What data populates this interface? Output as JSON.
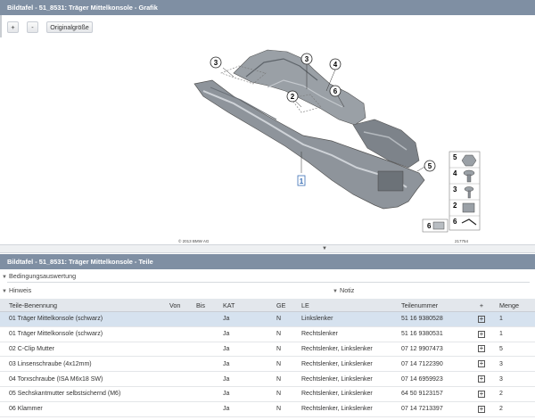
{
  "graphic_panel": {
    "title": "Bildtafel - 51_8531: Träger Mittelkonsole - Grafik"
  },
  "toolbar": {
    "zoom_in": "+",
    "zoom_out": "-",
    "original_size": "Originalgröße"
  },
  "diagram": {
    "callouts": [
      "3",
      "3",
      "4",
      "2",
      "6",
      "1",
      "5"
    ],
    "side_callouts": [
      "5",
      "4",
      "3",
      "2",
      "6"
    ],
    "copyright": "© 2013 BMW AG",
    "figure_number": "217754"
  },
  "parts_panel": {
    "title": "Bildtafel - 51_8531: Träger Mittelkonsole - Teile",
    "conditions_label": "Bedingungsauswertung",
    "hint_label": "Hinweis",
    "note_label": "Notiz",
    "columns": [
      "Teile-Benennung",
      "Von",
      "Bis",
      "KAT",
      "GE",
      "LE",
      "Teilenummer",
      "+",
      "Menge"
    ],
    "rows": [
      {
        "name": "01 Träger Mittelkonsole (schwarz)",
        "von": "",
        "bis": "",
        "kat": "Ja",
        "ge": "N",
        "le": "Linkslenker",
        "part": "51 16 9380528",
        "qty": "1"
      },
      {
        "name": "01 Träger Mittelkonsole (schwarz)",
        "von": "",
        "bis": "",
        "kat": "Ja",
        "ge": "N",
        "le": "Rechtslenker",
        "part": "51 16 9380531",
        "qty": "1"
      },
      {
        "name": "02 C-Clip Mutter",
        "von": "",
        "bis": "",
        "kat": "Ja",
        "ge": "N",
        "le": "Rechtslenker, Linkslenker",
        "part": "07 12 9907473",
        "qty": "5"
      },
      {
        "name": "03 Linsenschraube (4x12mm)",
        "von": "",
        "bis": "",
        "kat": "Ja",
        "ge": "N",
        "le": "Rechtslenker, Linkslenker",
        "part": "07 14 7122390",
        "qty": "3"
      },
      {
        "name": "04 Torxschraube (ISA M6x18 SW)",
        "von": "",
        "bis": "",
        "kat": "Ja",
        "ge": "N",
        "le": "Rechtslenker, Linkslenker",
        "part": "07 14 6959923",
        "qty": "3"
      },
      {
        "name": "05 Sechskantmutter selbstsichernd (M6)",
        "von": "",
        "bis": "",
        "kat": "Ja",
        "ge": "N",
        "le": "Rechtslenker, Linkslenker",
        "part": "64 50 9123157",
        "qty": "2"
      },
      {
        "name": "06 Klammer",
        "von": "",
        "bis": "",
        "kat": "Ja",
        "ge": "N",
        "le": "Rechtslenker, Linkslenker",
        "part": "07 14 7213397",
        "qty": "2"
      }
    ],
    "add_symbol": "+"
  }
}
